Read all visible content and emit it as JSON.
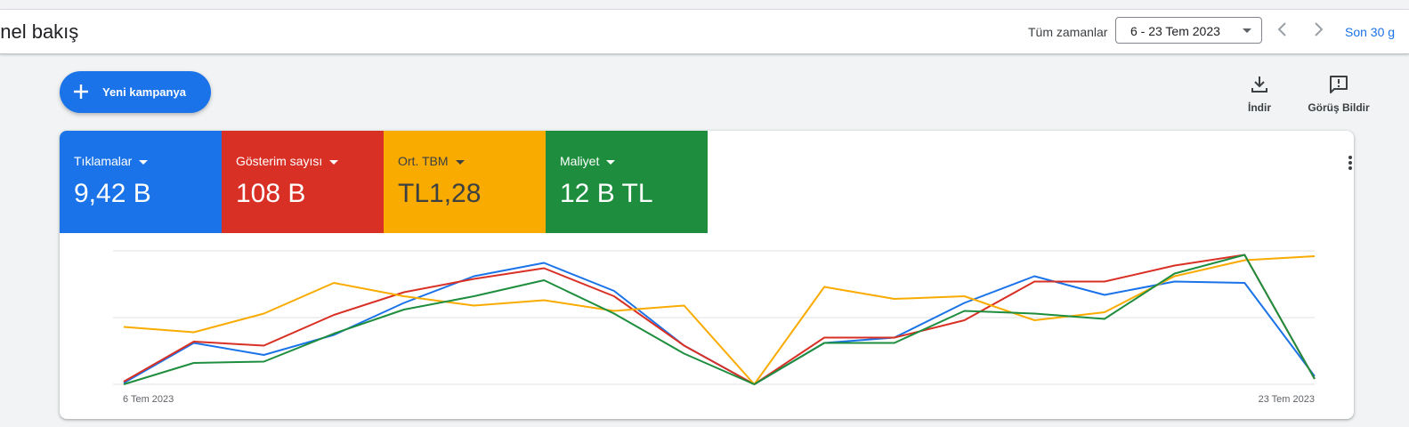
{
  "header": {
    "title": "enel bakış",
    "time_label": "Tüm zamanlar",
    "date_range": "6 - 23 Tem 2023",
    "period_link": "Son 30 g"
  },
  "actions": {
    "new_campaign": "Yeni kampanya",
    "download": "İndir",
    "feedback": "Görüş Bildir"
  },
  "metrics": [
    {
      "label": "Tıklamalar",
      "value": "9,42 B",
      "color": "#1a73e8",
      "text_color": "#ffffff"
    },
    {
      "label": "Gösterim sayısı",
      "value": "108 B",
      "color": "#d93025",
      "text_color": "#ffffff"
    },
    {
      "label": "Ort. TBM",
      "value": "TL1,28",
      "color": "#f9ab00",
      "text_color": "#3c4043"
    },
    {
      "label": "Maliyet",
      "value": "12 B TL",
      "color": "#1e8e3e",
      "text_color": "#ffffff"
    }
  ],
  "chart_data": {
    "type": "line",
    "x_labels": [
      "6 Tem 2023",
      "23 Tem 2023"
    ],
    "ylim": [
      0,
      100
    ],
    "grid": true,
    "series": [
      {
        "color": "#1a73e8",
        "values": [
          1,
          31,
          22,
          37,
          61,
          81,
          91,
          70,
          29,
          0,
          31,
          35,
          61,
          81,
          67,
          77,
          76,
          6
        ]
      },
      {
        "color": "#d93025",
        "values": [
          2,
          32,
          29,
          52,
          69,
          79,
          87,
          66,
          29,
          0,
          35,
          35,
          48,
          77,
          77,
          89,
          97,
          4
        ]
      },
      {
        "color": "#f9ab00",
        "values": [
          43,
          39,
          53,
          76,
          66,
          59,
          63,
          55,
          59,
          0,
          73,
          64,
          66,
          48,
          54,
          81,
          93,
          96
        ]
      },
      {
        "color": "#1e8e3e",
        "values": [
          0,
          16,
          17,
          38,
          56,
          66,
          78,
          53,
          23,
          0,
          31,
          31,
          55,
          53,
          49,
          83,
          97,
          4
        ]
      }
    ]
  }
}
